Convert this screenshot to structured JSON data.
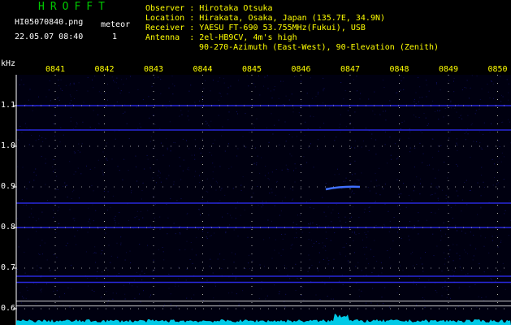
{
  "header": {
    "app_title": "HROFFT",
    "filename": "HI05070840.png",
    "meteor_label": "meteor",
    "datetime": "22.05.07 08:40",
    "meteor_count": "1",
    "info": [
      {
        "key": "Observer ",
        "value": "Hirotaka Otsuka"
      },
      {
        "key": "Location ",
        "value": "Hirakata, Osaka, Japan (135.7E, 34.9N)"
      },
      {
        "key": "Receiver ",
        "value": "YAESU FT-690 53.755MHz(Fukui), USB"
      },
      {
        "key": "Antenna  ",
        "value": "2el-HB9CV, 4m's high"
      },
      {
        "key": "",
        "value": "90-270-Azimuth (East-West), 90-Elevation (Zenith)"
      }
    ]
  },
  "spectrogram": {
    "y_unit": "kHz",
    "x_ticks": [
      "0841",
      "0842",
      "0843",
      "0844",
      "0845",
      "0846",
      "0847",
      "0848",
      "0849",
      "0850"
    ],
    "y_ticks": [
      "1.1",
      "1.0",
      "0.9",
      "0.8",
      "0.7",
      "0.6"
    ],
    "colors": {
      "background": "#000010",
      "signal": "#3030ff",
      "grid": "#ffffff",
      "x_tick_text": "#ffff00",
      "info_text": "#ffff00",
      "title": "#00c800",
      "noise": "#00e0ff"
    },
    "meteor_event": {
      "time": "0847",
      "freq_khz": 0.9
    }
  }
}
